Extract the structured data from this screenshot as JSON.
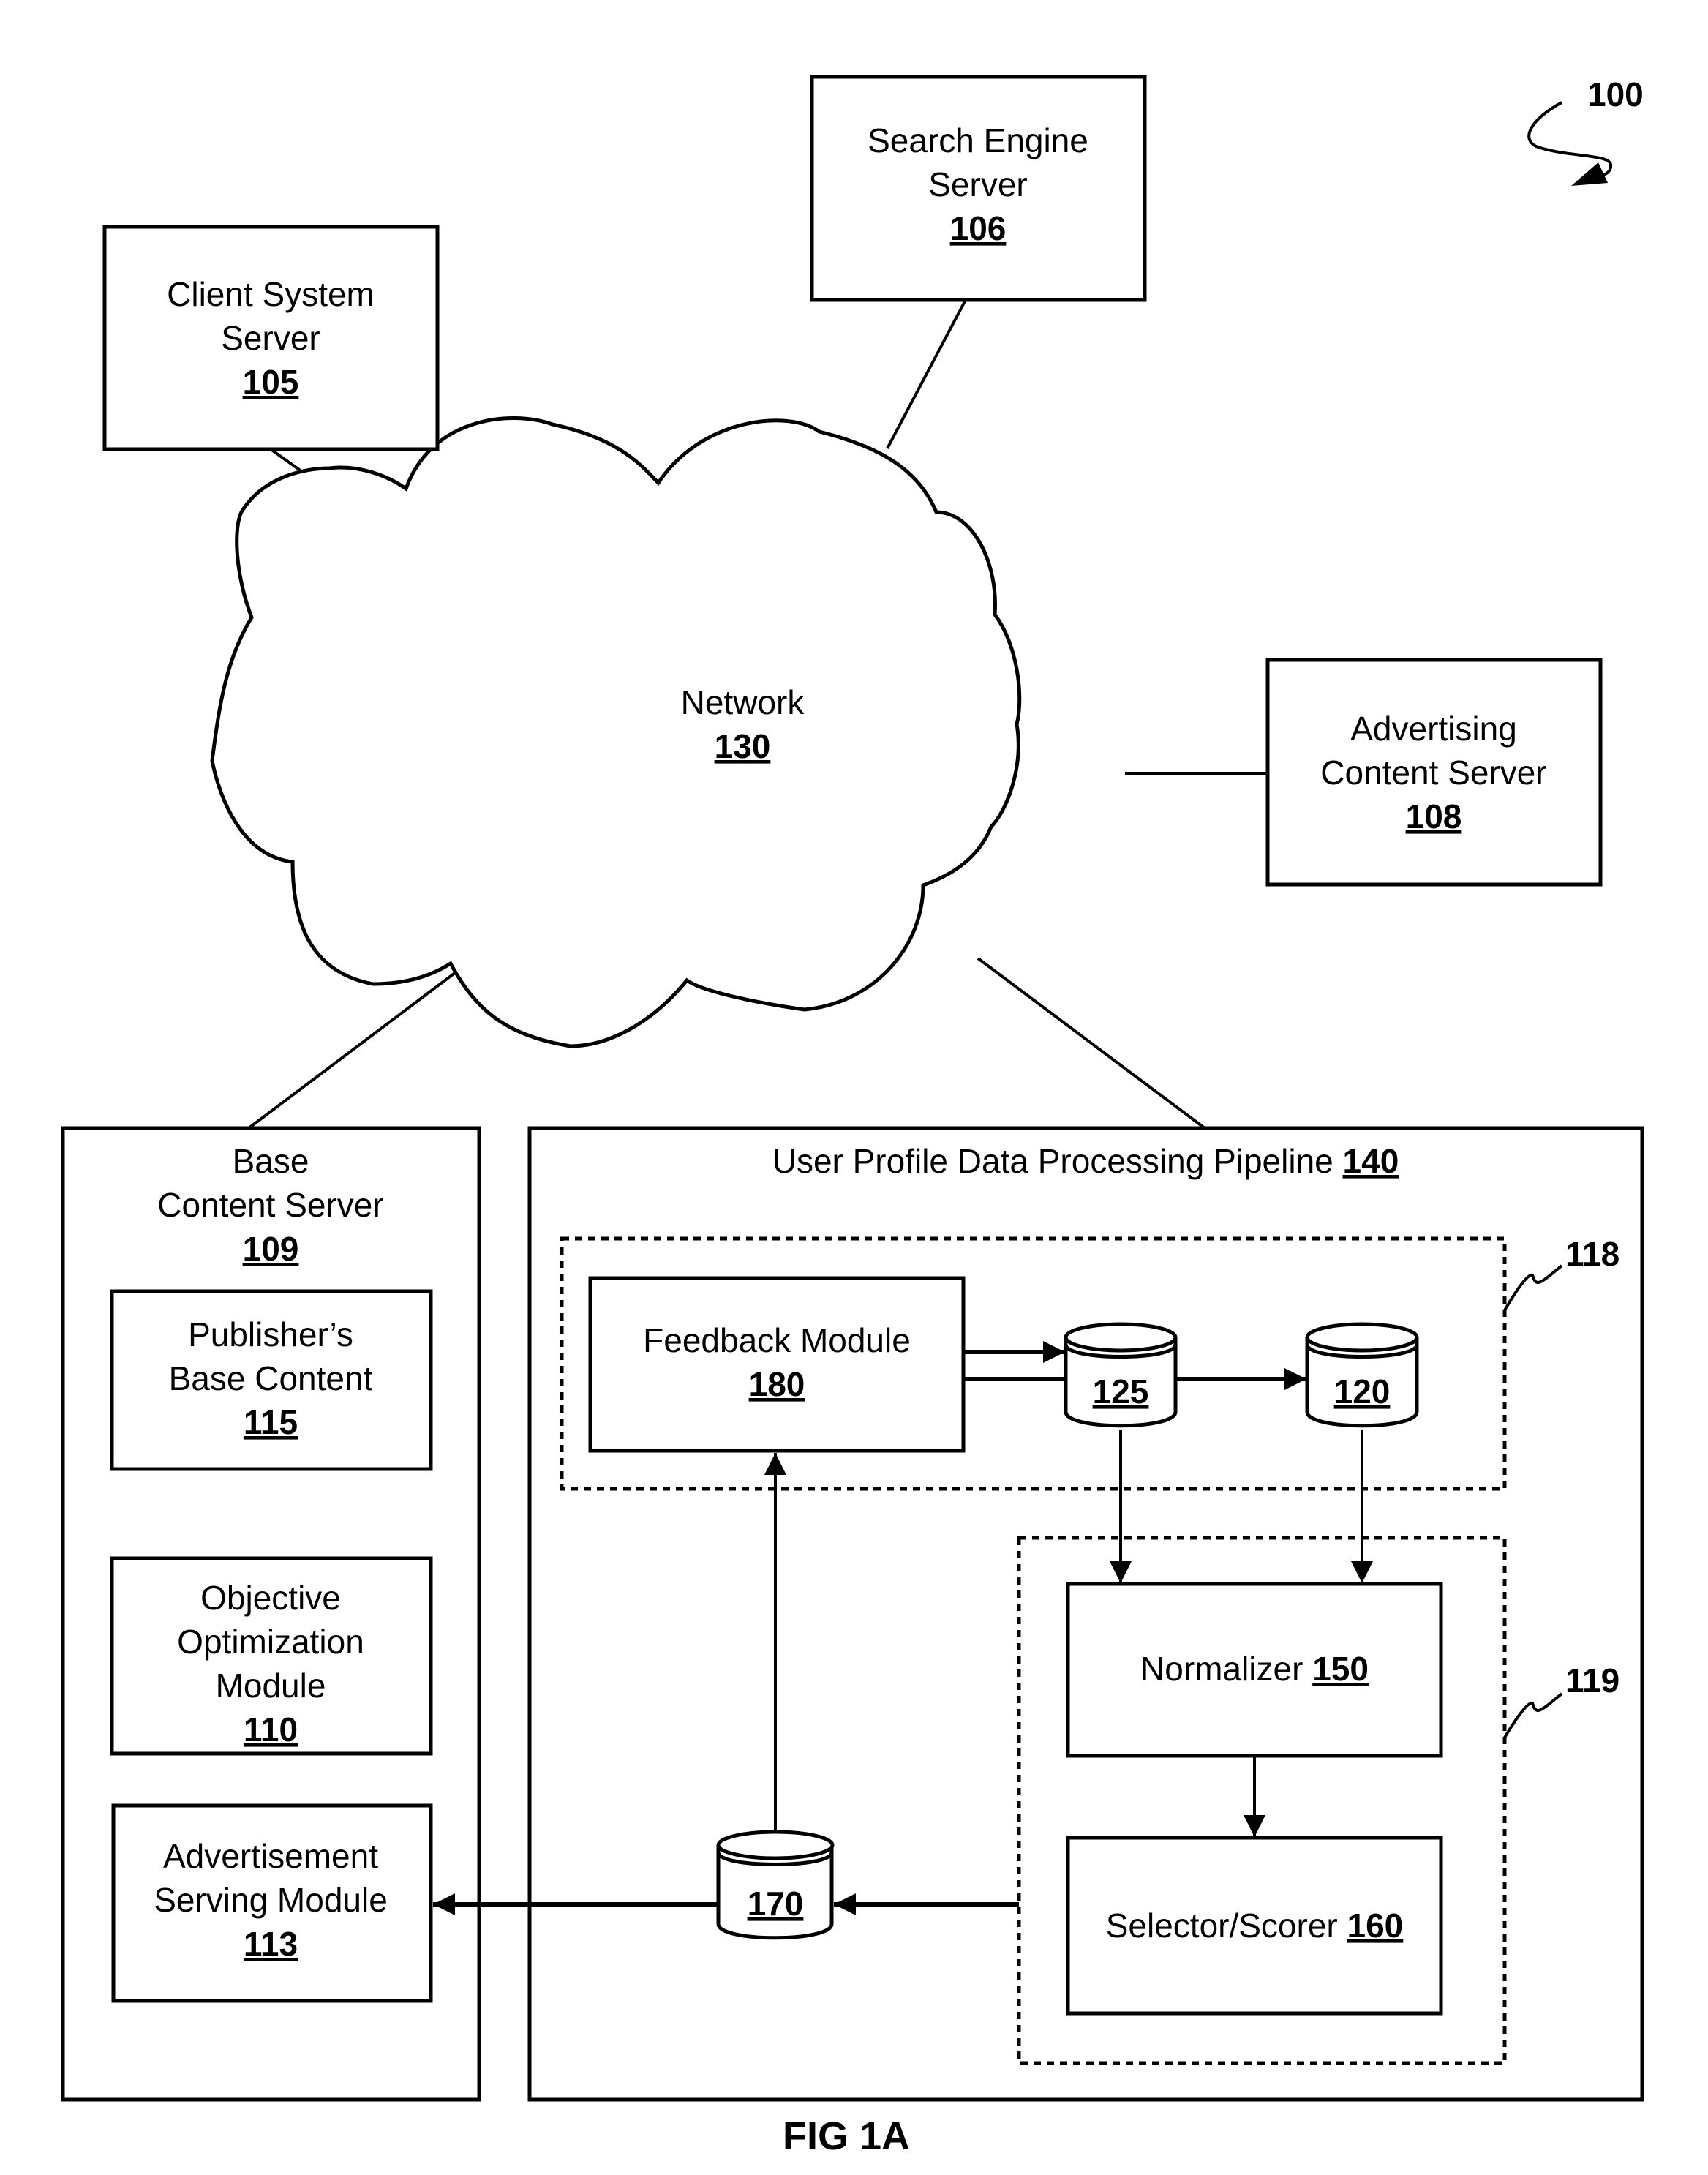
{
  "figure": {
    "label": "FIG  1A",
    "ref": "100",
    "background": "#ffffff",
    "ink": "#000000"
  },
  "nodes": {
    "search_engine": {
      "lines": [
        "Search Engine",
        "Server"
      ],
      "num": "106"
    },
    "client_system": {
      "lines": [
        "Client System",
        "Server"
      ],
      "num": "105"
    },
    "network": {
      "lines": [
        "Network"
      ],
      "num": "130"
    },
    "advertising_content": {
      "lines": [
        "Advertising",
        "Content Server"
      ],
      "num": "108"
    },
    "base_content": {
      "lines": [
        "Base",
        "Content Server"
      ],
      "num": "109",
      "children": {
        "publishers_base": {
          "lines": [
            "Publisher’s",
            "Base Content"
          ],
          "num": "115"
        },
        "objective_optimization": {
          "lines": [
            "Objective",
            "Optimization",
            "Module"
          ],
          "num": "110"
        },
        "ad_serving": {
          "lines": [
            "Advertisement",
            "Serving Module"
          ],
          "num": "113"
        }
      }
    },
    "pipeline": {
      "title": "User Profile Data Processing Pipeline ",
      "num": "140",
      "group_118": {
        "ref": "118"
      },
      "group_119": {
        "ref": "119"
      },
      "feedback": {
        "lines": [
          "Feedback Module"
        ],
        "num": "180"
      },
      "db_125": {
        "num": "125"
      },
      "db_120": {
        "num": "120"
      },
      "db_170": {
        "num": "170"
      },
      "normalizer": {
        "label": "Normalizer ",
        "num": "150"
      },
      "selector": {
        "label": "Selector/Scorer ",
        "num": "160"
      }
    }
  },
  "connections": [
    {
      "from": "client_system",
      "to": "network",
      "type": "line"
    },
    {
      "from": "search_engine",
      "to": "network",
      "type": "line"
    },
    {
      "from": "advertising_content",
      "to": "network",
      "type": "line"
    },
    {
      "from": "base_content",
      "to": "network",
      "type": "line"
    },
    {
      "from": "pipeline",
      "to": "network",
      "type": "line"
    },
    {
      "from": "feedback",
      "to": "db_125",
      "type": "arrow"
    },
    {
      "from": "db_125",
      "to": "db_120",
      "type": "arrow"
    },
    {
      "from": "db_125",
      "to": "normalizer",
      "type": "arrow"
    },
    {
      "from": "db_120",
      "to": "normalizer",
      "type": "arrow"
    },
    {
      "from": "normalizer",
      "to": "selector",
      "type": "arrow"
    },
    {
      "from": "group_119",
      "to": "db_170",
      "type": "arrow"
    },
    {
      "from": "db_170",
      "to": "ad_serving",
      "type": "arrow"
    },
    {
      "from": "db_170",
      "to": "feedback",
      "type": "arrow"
    }
  ]
}
